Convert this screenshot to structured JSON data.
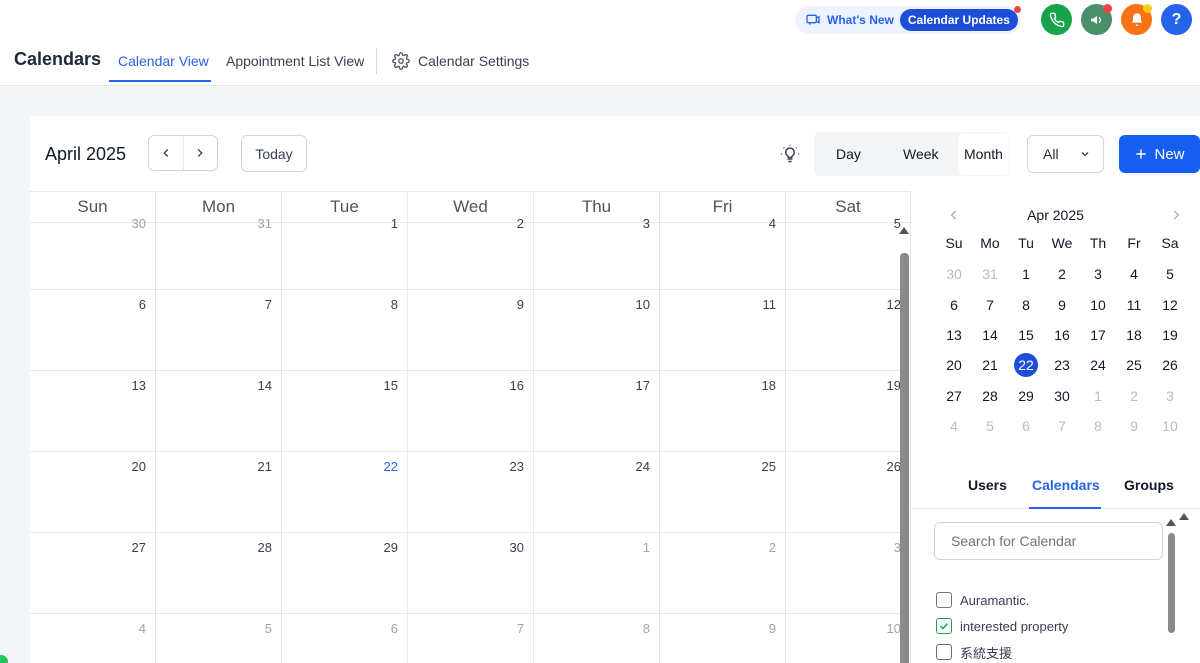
{
  "header": {
    "title": "Calendars",
    "tabs": [
      {
        "label": "Calendar View"
      },
      {
        "label": "Appointment List View"
      }
    ],
    "settings_label": "Calendar Settings",
    "whats_new": {
      "label": "What's New",
      "pill": "Calendar Updates"
    },
    "help_label": "?"
  },
  "toolbar": {
    "month_title": "April 2025",
    "today_label": "Today",
    "views": [
      "Day",
      "Week",
      "Month"
    ],
    "selected_view": "Month",
    "filter_value": "All",
    "new_label": "New"
  },
  "grid": {
    "weekdays": [
      "Sun",
      "Mon",
      "Tue",
      "Wed",
      "Thu",
      "Fri",
      "Sat"
    ],
    "weeks": [
      [
        "30",
        "31",
        "1",
        "2",
        "3",
        "4",
        "5"
      ],
      [
        "6",
        "7",
        "8",
        "9",
        "10",
        "11",
        "12"
      ],
      [
        "13",
        "14",
        "15",
        "16",
        "17",
        "18",
        "19"
      ],
      [
        "20",
        "21",
        "22",
        "23",
        "24",
        "25",
        "26"
      ],
      [
        "27",
        "28",
        "29",
        "30",
        "1",
        "2",
        "3"
      ],
      [
        "4",
        "5",
        "6",
        "7",
        "8",
        "9",
        "10"
      ]
    ]
  },
  "mini_calendar": {
    "title": "Apr 2025",
    "weekdays": [
      "Su",
      "Mo",
      "Tu",
      "We",
      "Th",
      "Fr",
      "Sa"
    ],
    "days": [
      "30",
      "31",
      "1",
      "2",
      "3",
      "4",
      "5",
      "6",
      "7",
      "8",
      "9",
      "10",
      "11",
      "12",
      "13",
      "14",
      "15",
      "16",
      "17",
      "18",
      "19",
      "20",
      "21",
      "22",
      "23",
      "24",
      "25",
      "26",
      "27",
      "28",
      "29",
      "30",
      "1",
      "2",
      "3",
      "4",
      "5",
      "6",
      "7",
      "8",
      "9",
      "10"
    ],
    "today": "22"
  },
  "side_tabs": [
    "Users",
    "Calendars",
    "Groups"
  ],
  "search": {
    "placeholder": "Search for Calendar"
  },
  "calendars": [
    {
      "label": "Auramantic.",
      "checked": false
    },
    {
      "label": "interested property",
      "checked": true
    },
    {
      "label": "系統支援",
      "checked": false
    }
  ],
  "colors": {
    "accent": "#2563eb",
    "primary_button": "#155eef",
    "phone": "#16a34a",
    "megaphone": "#4b8f6a",
    "bell": "#f97316",
    "help": "#2563eb"
  }
}
